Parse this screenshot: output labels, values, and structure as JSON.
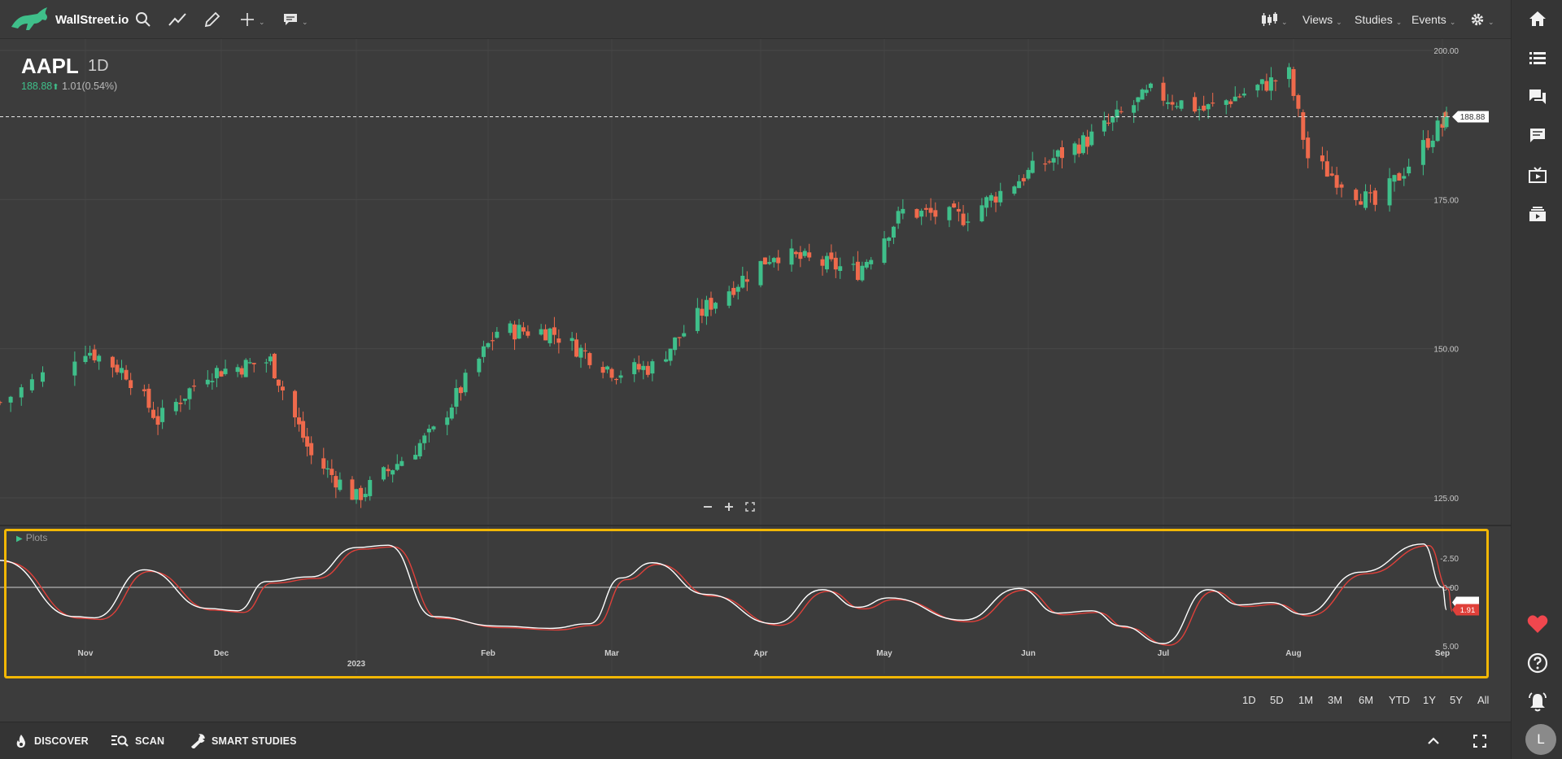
{
  "app": {
    "brand": "WallStreet.io"
  },
  "toolbar": {
    "views_label": "Views",
    "studies_label": "Studies",
    "events_label": "Events"
  },
  "header": {
    "symbol": "AAPL",
    "interval": "1D",
    "price": "188.88",
    "change": "1.01(0.54%)"
  },
  "study": {
    "label": "Plots"
  },
  "ranges": [
    "1D",
    "5D",
    "1M",
    "3M",
    "6M",
    "YTD",
    "1Y",
    "5Y",
    "All"
  ],
  "bottom": {
    "discover": "DISCOVER",
    "scan": "SCAN",
    "smart_studies": "SMART STUDIES"
  },
  "user": {
    "initial": "L"
  },
  "colors": {
    "up": "#3fbf8a",
    "down": "#ef6a4c",
    "highlight": "#f2b705",
    "signal": "#e0403a"
  },
  "icons": [
    "search-icon",
    "trend-line-icon",
    "pencil-icon",
    "crosshair-icon",
    "comment-icon",
    "candles-icon",
    "gear-icon",
    "home-icon",
    "list-icon",
    "chat-icon",
    "message-icon",
    "video-icon",
    "layers-icon",
    "heart-icon",
    "help-icon",
    "bell-icon",
    "fire-icon",
    "scan-icon",
    "wrench-icon",
    "chevron-up-icon",
    "fullscreen-icon"
  ],
  "chart_data": {
    "type": "candlestick",
    "symbol": "AAPL",
    "interval": "1D",
    "last_price": 188.88,
    "last_price_label": "188.88",
    "y_ticks": [
      "200.00",
      "175.00",
      "150.00",
      "125.00"
    ],
    "y_range": [
      121,
      203
    ],
    "x_ticks": [
      "Nov",
      "Dec",
      "2023",
      "Feb",
      "Mar",
      "Apr",
      "May",
      "Jun",
      "Jul",
      "Aug",
      "Sep"
    ],
    "anchors": [
      {
        "date": "Oct 24",
        "close": 141
      },
      {
        "date": "Nov 1",
        "close": 150
      },
      {
        "date": "Nov 10",
        "close": 146
      },
      {
        "date": "Nov 17",
        "close": 138
      },
      {
        "date": "Nov 28",
        "close": 146
      },
      {
        "date": "Dec 13",
        "close": 148
      },
      {
        "date": "Dec 23",
        "close": 132
      },
      {
        "date": "Jan 3",
        "close": 125
      },
      {
        "date": "Jan 20",
        "close": 136
      },
      {
        "date": "Feb 3",
        "close": 153
      },
      {
        "date": "Feb 15",
        "close": 153
      },
      {
        "date": "Mar 2",
        "close": 146
      },
      {
        "date": "Mar 10",
        "close": 147
      },
      {
        "date": "Mar 22",
        "close": 157
      },
      {
        "date": "Apr 6",
        "close": 166
      },
      {
        "date": "Apr 25",
        "close": 163
      },
      {
        "date": "May 5",
        "close": 173
      },
      {
        "date": "May 18",
        "close": 172
      },
      {
        "date": "Jun 2",
        "close": 180
      },
      {
        "date": "Jun 15",
        "close": 185
      },
      {
        "date": "Jun 30",
        "close": 193
      },
      {
        "date": "Jul 12",
        "close": 190
      },
      {
        "date": "Jul 31",
        "close": 196
      },
      {
        "date": "Aug 4",
        "close": 182
      },
      {
        "date": "Aug 18",
        "close": 174
      },
      {
        "date": "Aug 31",
        "close": 187
      },
      {
        "date": "Sep 6",
        "close": 188.88
      }
    ],
    "study": {
      "name": "Plots",
      "y_ticks": [
        "5.00",
        "0.00",
        "-2.50"
      ],
      "y_range": [
        -4.2,
        4.6
      ],
      "last_value_label": "1.91",
      "fast_line": "white",
      "slow_line": "red",
      "points": [
        {
          "date": "Oct 24",
          "value": -2.3
        },
        {
          "date": "Oct 31",
          "value": 2.5
        },
        {
          "date": "Nov 3",
          "value": 2.6
        },
        {
          "date": "Nov 14",
          "value": -1.5
        },
        {
          "date": "Nov 28",
          "value": 1.8
        },
        {
          "date": "Dec 5",
          "value": 2.0
        },
        {
          "date": "Dec 12",
          "value": -0.5
        },
        {
          "date": "Dec 23",
          "value": -0.9
        },
        {
          "date": "Jan 3",
          "value": -3.4
        },
        {
          "date": "Jan 10",
          "value": -3.6
        },
        {
          "date": "Jan 20",
          "value": 2.5
        },
        {
          "date": "Feb 3",
          "value": 3.3
        },
        {
          "date": "Feb 15",
          "value": 3.5
        },
        {
          "date": "Feb 24",
          "value": 3.1
        },
        {
          "date": "Mar 3",
          "value": -0.8
        },
        {
          "date": "Mar 10",
          "value": -2.1
        },
        {
          "date": "Mar 22",
          "value": 0.6
        },
        {
          "date": "Apr 6",
          "value": 3.1
        },
        {
          "date": "Apr 17",
          "value": 0.2
        },
        {
          "date": "Apr 25",
          "value": 1.7
        },
        {
          "date": "May 2",
          "value": 0.9
        },
        {
          "date": "May 18",
          "value": 2.8
        },
        {
          "date": "May 30",
          "value": 0.1
        },
        {
          "date": "Jun 8",
          "value": 2.2
        },
        {
          "date": "Jun 16",
          "value": 2.0
        },
        {
          "date": "Jun 23",
          "value": 3.3
        },
        {
          "date": "Jul 3",
          "value": 4.8
        },
        {
          "date": "Jul 13",
          "value": 0.2
        },
        {
          "date": "Jul 20",
          "value": 1.5
        },
        {
          "date": "Jul 27",
          "value": 1.3
        },
        {
          "date": "Aug 3",
          "value": 2.3
        },
        {
          "date": "Aug 15",
          "value": -1.3
        },
        {
          "date": "Aug 28",
          "value": -3.7
        },
        {
          "date": "Sep 1",
          "value": 0.0
        },
        {
          "date": "Sep 6",
          "value": 1.91
        }
      ]
    }
  }
}
